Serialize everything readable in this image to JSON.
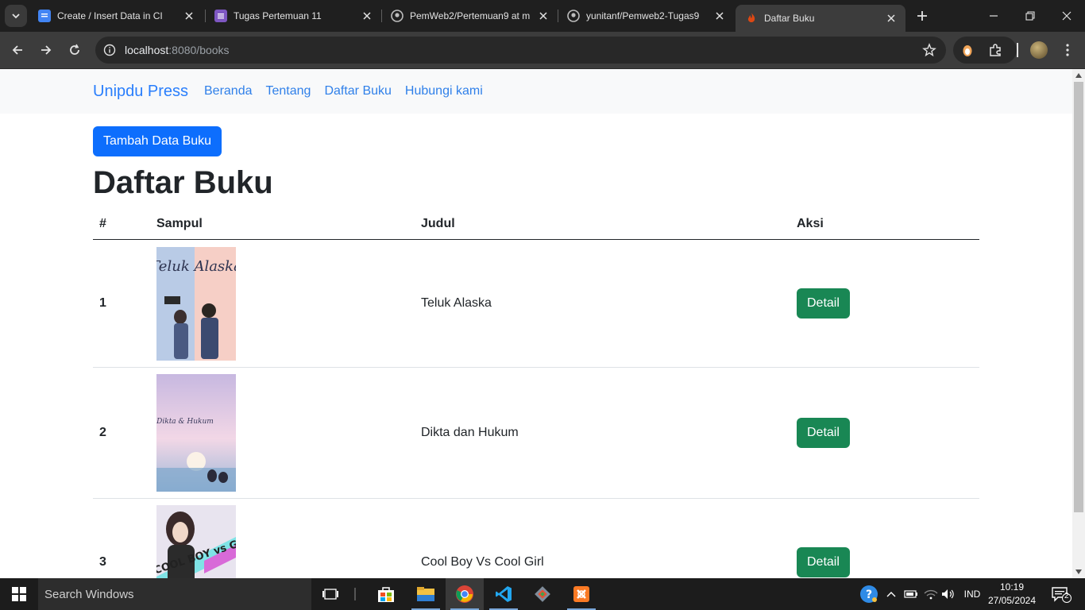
{
  "browser": {
    "tabs": [
      {
        "title": "Create / Insert Data in CI",
        "icon": "google-docs-icon",
        "color": "#4285f4"
      },
      {
        "title": "Tugas Pertemuan 11",
        "icon": "forms-icon",
        "color": "#7e57c2"
      },
      {
        "title": "PemWeb2/Pertemuan9 at m",
        "icon": "github-icon",
        "color": "#e3e3e3"
      },
      {
        "title": "yunitanf/Pemweb2-Tugas9",
        "icon": "github-icon",
        "color": "#e3e3e3"
      },
      {
        "title": "Daftar Buku",
        "icon": "codeigniter-icon",
        "color": "#dd4814"
      }
    ],
    "url_host": "localhost",
    "url_rest": ":8080/books"
  },
  "site": {
    "brand": "Unipdu Press",
    "nav": [
      "Beranda",
      "Tentang",
      "Daftar Buku",
      "Hubungi kami"
    ]
  },
  "page": {
    "add_button": "Tambah Data Buku",
    "title": "Daftar Buku",
    "columns": [
      "#",
      "Sampul",
      "Judul",
      "Aksi"
    ],
    "rows": [
      {
        "no": "1",
        "title": "Teluk Alaska",
        "action": "Detail",
        "cover": {
          "text": "Teluk Alaska",
          "bg1": "#b9cbe6",
          "bg2": "#f6cfc6"
        }
      },
      {
        "no": "2",
        "title": "Dikta dan Hukum",
        "action": "Detail",
        "cover": {
          "text": "Dikta & Hukum",
          "bg1": "#c7b8e0",
          "bg2": "#f2d7e6"
        }
      },
      {
        "no": "3",
        "title": "Cool Boy Vs Cool Girl",
        "action": "Detail",
        "cover": {
          "text": "COOL BOY vs GIRL",
          "bg1": "#e8e4ef",
          "bg2": "#d9f2f2"
        }
      }
    ]
  },
  "taskbar": {
    "search_placeholder": "Search Windows",
    "language": "IND",
    "time": "10:19",
    "date": "27/05/2024",
    "notifications": "2"
  },
  "colors": {
    "primary": "#0d6efd",
    "success": "#198754"
  }
}
